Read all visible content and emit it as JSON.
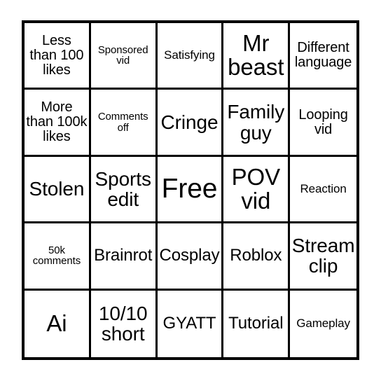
{
  "card": {
    "type": "bingo-card",
    "rows": 5,
    "columns": 5,
    "border_color": "#000000",
    "background_color": "#ffffff",
    "text_color": "#000000",
    "cells": [
      [
        {
          "text": "Less\nthan 100\nlikes",
          "size": "m"
        },
        {
          "text": "Sponsored\nvid",
          "size": "xs"
        },
        {
          "text": "Satisfying",
          "size": "s"
        },
        {
          "text": "Mr\nbeast",
          "size": "xxl"
        },
        {
          "text": "Different\nlanguage",
          "size": "m"
        }
      ],
      [
        {
          "text": "More\nthan 100k\nlikes",
          "size": "m"
        },
        {
          "text": "Comments\noff",
          "size": "xs"
        },
        {
          "text": "Cringe",
          "size": "xl"
        },
        {
          "text": "Family\nguy",
          "size": "xl"
        },
        {
          "text": "Looping\nvid",
          "size": "m"
        }
      ],
      [
        {
          "text": "Stolen",
          "size": "xl"
        },
        {
          "text": "Sports\nedit",
          "size": "xl"
        },
        {
          "text": "Free",
          "size": "max"
        },
        {
          "text": "POV\nvid",
          "size": "xxl"
        },
        {
          "text": "Reaction",
          "size": "s"
        }
      ],
      [
        {
          "text": "50k\ncomments",
          "size": "xs"
        },
        {
          "text": "Brainrot",
          "size": "l"
        },
        {
          "text": "Cosplay",
          "size": "l"
        },
        {
          "text": "Roblox",
          "size": "l"
        },
        {
          "text": "Stream\nclip",
          "size": "xl"
        }
      ],
      [
        {
          "text": "Ai",
          "size": "xxl"
        },
        {
          "text": "10/10\nshort",
          "size": "xl"
        },
        {
          "text": "GYATT",
          "size": "l"
        },
        {
          "text": "Tutorial",
          "size": "l"
        },
        {
          "text": "Gameplay",
          "size": "s"
        }
      ]
    ]
  }
}
